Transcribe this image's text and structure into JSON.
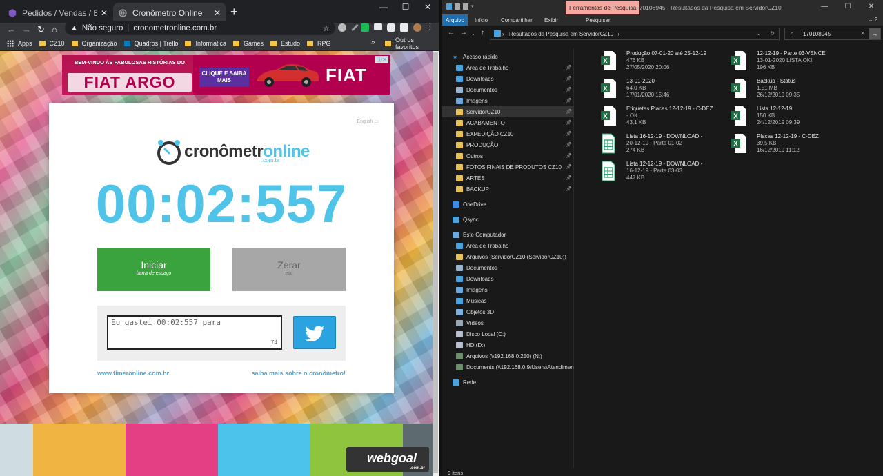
{
  "browser": {
    "tabs": [
      {
        "title": "Pedidos / Vendas / Biz Painel",
        "active": false
      },
      {
        "title": "Cronômetro Online",
        "active": true
      }
    ],
    "address": {
      "security": "Não seguro",
      "url": "cronometronline.com.br"
    },
    "bookmarks": [
      "Apps",
      "CZ10",
      "Organização",
      "Quadros | Trello",
      "Informatica",
      "Games",
      "Estudo",
      "RPG"
    ],
    "bookmarks_more": "»",
    "other_bookmarks": "Outros favoritos",
    "window_controls": [
      "—",
      "☐",
      "✕"
    ]
  },
  "ad": {
    "headline": "BEM-VINDO ÀS FABULOSAS HISTÓRIAS DO",
    "product": "FIAT ARGO",
    "cta": "CLIQUE E SAIBA MAIS",
    "brand": "FIAT"
  },
  "stopwatch": {
    "language_link": "English",
    "logo_main": "cronômetr",
    "logo_accent": "online",
    "logo_domain": ".com.br",
    "time": "00:02:557",
    "start_label": "Iniciar",
    "start_hint": "barra de espaço",
    "reset_label": "Zerar",
    "reset_hint": "esc",
    "share_text": "Eu gastei 00:02:557 para",
    "char_count": "74",
    "link_left": "www.timeronline.com.br",
    "link_right": "saiba mais sobre o cronômetro!",
    "footer_colors": [
      "#cfdde3",
      "#f0b443",
      "#e43f84",
      "#4bc3ea",
      "#8fc43f",
      "#5d6a70"
    ],
    "sponsor": "webgoal",
    "sponsor_domain": ".com.br"
  },
  "explorer": {
    "contextual_tab": "Ferramentas de Pesquisa",
    "window_title": "170108945 - Resultados da Pesquisa em ServidorCZ10",
    "ribbon": {
      "file": "Arquivo",
      "tabs": [
        "Início",
        "Compartilhar",
        "Exibir"
      ],
      "search_tab": "Pesquisar"
    },
    "address": "Resultados da Pesquisa em ServidorCZ10",
    "search_query": "170108945",
    "nav": [
      {
        "label": "Acesso rápido",
        "kind": "star",
        "indent": 0,
        "pinned": false
      },
      {
        "label": "Área de Trabalho",
        "kind": "desk",
        "indent": 1,
        "pinned": true
      },
      {
        "label": "Downloads",
        "kind": "down",
        "indent": 1,
        "pinned": true
      },
      {
        "label": "Documentos",
        "kind": "doc",
        "indent": 1,
        "pinned": true
      },
      {
        "label": "Imagens",
        "kind": "img",
        "indent": 1,
        "pinned": true
      },
      {
        "label": "ServidorCZ10",
        "kind": "folder",
        "indent": 1,
        "pinned": true,
        "selected": true
      },
      {
        "label": "ACABAMENTO",
        "kind": "folder",
        "indent": 1,
        "pinned": true
      },
      {
        "label": "EXPEDIÇÃO CZ10",
        "kind": "folder",
        "indent": 1,
        "pinned": true
      },
      {
        "label": "PRODUÇÃO",
        "kind": "folder",
        "indent": 1,
        "pinned": true
      },
      {
        "label": "Outros",
        "kind": "folder",
        "indent": 1,
        "pinned": true
      },
      {
        "label": "FOTOS FINAIS DE PRODUTOS CZ10",
        "kind": "folder",
        "indent": 1,
        "pinned": true
      },
      {
        "label": "ARTES",
        "kind": "folder",
        "indent": 1,
        "pinned": true
      },
      {
        "label": "BACKUP",
        "kind": "folder",
        "indent": 1,
        "pinned": true
      },
      {
        "label": "OneDrive",
        "kind": "cloud",
        "indent": 0,
        "pinned": false
      },
      {
        "label": "Qsync",
        "kind": "sync",
        "indent": 0,
        "pinned": false
      },
      {
        "label": "Este Computador",
        "kind": "pc",
        "indent": 0,
        "pinned": false
      },
      {
        "label": "Área de Trabalho",
        "kind": "desk",
        "indent": 1,
        "pinned": false
      },
      {
        "label": "Arquivos (ServidorCZ10 (ServidorCZ10))",
        "kind": "folder",
        "indent": 1,
        "pinned": false
      },
      {
        "label": "Documentos",
        "kind": "doc",
        "indent": 1,
        "pinned": false
      },
      {
        "label": "Downloads",
        "kind": "down",
        "indent": 1,
        "pinned": false
      },
      {
        "label": "Imagens",
        "kind": "img",
        "indent": 1,
        "pinned": false
      },
      {
        "label": "Músicas",
        "kind": "music",
        "indent": 1,
        "pinned": false
      },
      {
        "label": "Objetos 3D",
        "kind": "obj",
        "indent": 1,
        "pinned": false
      },
      {
        "label": "Vídeos",
        "kind": "video",
        "indent": 1,
        "pinned": false
      },
      {
        "label": "Disco Local (C:)",
        "kind": "drive",
        "indent": 1,
        "pinned": false
      },
      {
        "label": "HD (D:)",
        "kind": "drive",
        "indent": 1,
        "pinned": false
      },
      {
        "label": "Arquivos (\\\\192.168.0.250) (N:)",
        "kind": "net",
        "indent": 1,
        "pinned": false
      },
      {
        "label": "Documents (\\\\192.168.0.9\\Users\\Atendimen",
        "kind": "net",
        "indent": 1,
        "pinned": false
      },
      {
        "label": "Rede",
        "kind": "netw",
        "indent": 0,
        "pinned": false
      }
    ],
    "files": [
      {
        "name": "Produção 07-01-20 até 25-12-19",
        "l2": "476 KB",
        "l3": "27/05/2020 20:06",
        "type": "xlsx"
      },
      {
        "name": "12-12-19 - Parte 03-VENCE",
        "l2": "13-01-2020 LISTA OK!",
        "l3": "196 KB",
        "type": "xlsx"
      },
      {
        "name": "13-01-2020",
        "l2": "64,0 KB",
        "l3": "17/01/2020 15:46",
        "type": "xlsx"
      },
      {
        "name": "Backup - Status",
        "l2": "1,51 MB",
        "l3": "26/12/2019 09:35",
        "type": "xlsx"
      },
      {
        "name": "Etiquetas Placas 12-12-19 - C-DEZ",
        "l2": "- OK",
        "l3": "43,1 KB",
        "type": "xlsx"
      },
      {
        "name": "Lista 12-12-19",
        "l2": "150 KB",
        "l3": "24/12/2019 09:39",
        "type": "xlsx"
      },
      {
        "name": "Lista 16-12-19 - DOWNLOAD -",
        "l2": "20-12-19 - Parte 01-02",
        "l3": "274 KB",
        "type": "sheet"
      },
      {
        "name": "Placas 12-12-19 - C-DEZ",
        "l2": "39,5 KB",
        "l3": "16/12/2019 11:12",
        "type": "xlsx"
      },
      {
        "name": "Lista 12-12-19 - DOWNLOAD -",
        "l2": "16-12-19 - Parte 03-03",
        "l3": "447 KB",
        "type": "sheet"
      }
    ],
    "status": "9 itens"
  }
}
